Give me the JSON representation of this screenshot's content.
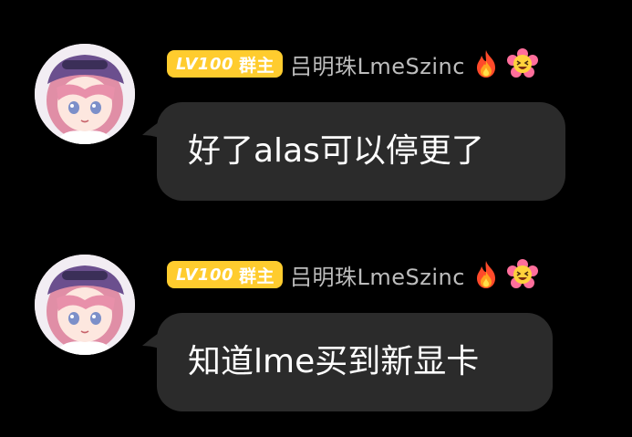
{
  "messages": [
    {
      "sender": {
        "level": "LV100",
        "role": "群主",
        "nickname": "吕明珠LmeSzinc",
        "badges": [
          "fire-icon",
          "grinning-flower-icon"
        ]
      },
      "text": "好了alas可以停更了"
    },
    {
      "sender": {
        "level": "LV100",
        "role": "群主",
        "nickname": "吕明珠LmeSzinc",
        "badges": [
          "fire-icon",
          "grinning-flower-icon"
        ]
      },
      "text": "知道lme买到新显卡"
    }
  ],
  "colors": {
    "background": "#000000",
    "bubble": "#2b2b2b",
    "badge": "#ffcc2e",
    "nickname": "#bdbdbd"
  }
}
